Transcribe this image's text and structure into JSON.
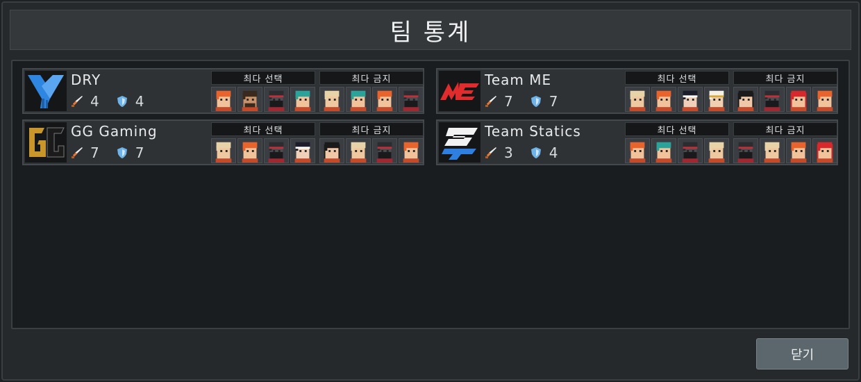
{
  "title": "팀 통계",
  "close_label": "닫기",
  "group_labels": {
    "most_picked": "최다 선택",
    "most_banned": "최다 금지"
  },
  "colors": {
    "sword": "#e07a3a",
    "shield": "#6fb3e8"
  },
  "teams": [
    {
      "name": "DRY",
      "attack": "4",
      "defense": "4",
      "logo": "dry-logo",
      "picks": [
        "orange-hair",
        "bald-brown",
        "masked-dark",
        "teal-hair"
      ],
      "bans": [
        "blonde-hair",
        "teal-hair",
        "orange-hair",
        "masked-dark"
      ]
    },
    {
      "name": "Team ME",
      "attack": "7",
      "defense": "7",
      "logo": "team-me-logo",
      "picks": [
        "blonde-hair",
        "orange-hair",
        "dark-ribbon",
        "gold-mage"
      ],
      "bans": [
        "dark-long-hair",
        "masked-dark",
        "red-hair",
        "orange-hair"
      ]
    },
    {
      "name": "GG Gaming",
      "attack": "7",
      "defense": "7",
      "logo": "gg-logo",
      "picks": [
        "blonde-hair",
        "orange-hair",
        "masked-dark",
        "dark-ribbon"
      ],
      "bans": [
        "dark-long-hair",
        "blonde-hair",
        "masked-dark",
        "orange-hair"
      ]
    },
    {
      "name": "Team Statics",
      "attack": "3",
      "defense": "4",
      "logo": "statics-logo",
      "picks": [
        "orange-hair",
        "teal-hair",
        "masked-dark",
        "blonde-hair"
      ],
      "bans": [
        "masked-dark",
        "blonde-hair",
        "orange-hair",
        "red-hair"
      ]
    }
  ]
}
